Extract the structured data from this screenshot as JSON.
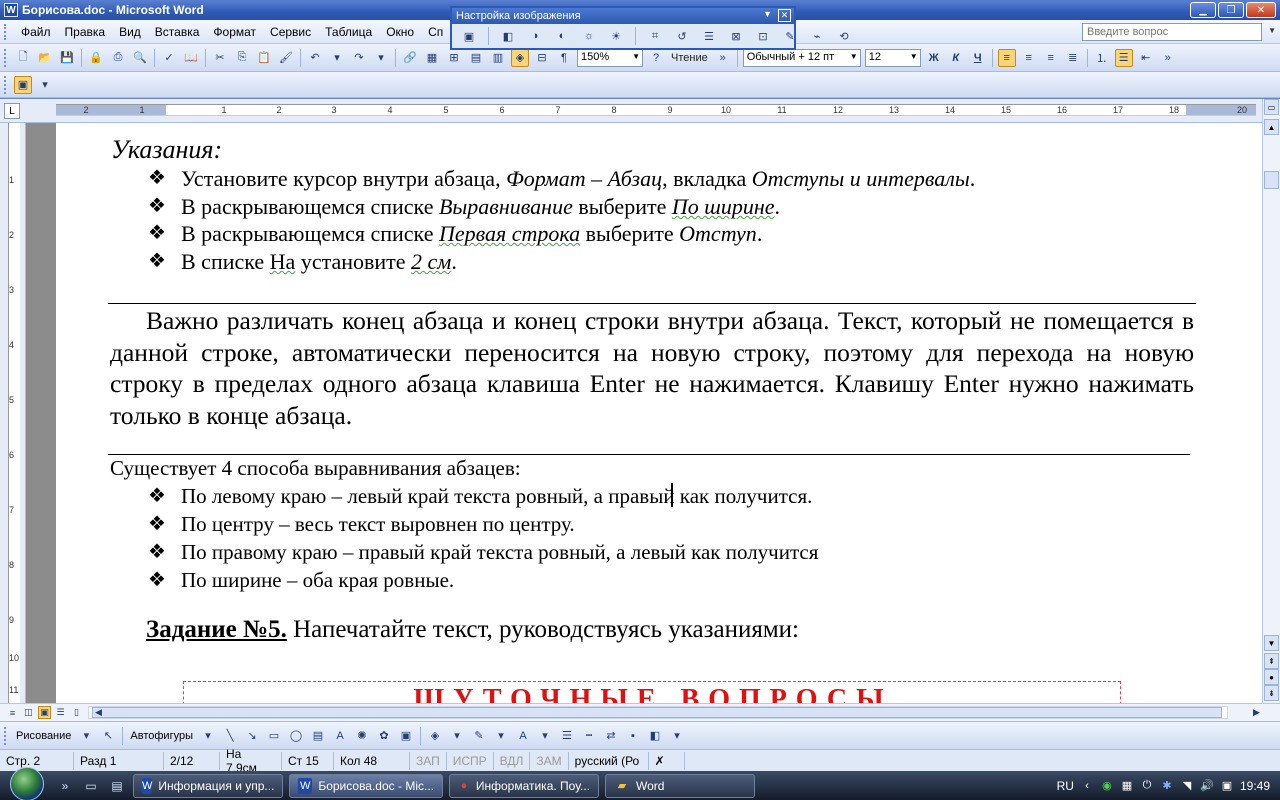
{
  "window": {
    "title": "Борисова.doc - Microsoft Word",
    "app_icon": "W"
  },
  "menu": {
    "items": [
      "Файл",
      "Правка",
      "Вид",
      "Вставка",
      "Формат",
      "Сервис",
      "Таблица",
      "Окно",
      "Сп"
    ],
    "ask_placeholder": "Введите вопрос"
  },
  "picture_toolbar": {
    "title": "Настройка изображения"
  },
  "toolbar": {
    "zoom": "150%",
    "reading": "Чтение",
    "style": "Обычный + 12 пт",
    "font_size": "12",
    "bold": "Ж",
    "italic": "К",
    "underline": "Ч"
  },
  "ruler": {
    "numbers": [
      "2",
      "1",
      "1",
      "2",
      "3",
      "4",
      "5",
      "6",
      "7",
      "8",
      "9",
      "10",
      "11",
      "12",
      "13",
      "14",
      "15",
      "16",
      "17",
      "18",
      "19",
      "20"
    ]
  },
  "vruler": {
    "numbers": [
      "1",
      "2",
      "3",
      "4",
      "5",
      "6",
      "7",
      "8",
      "9",
      "10",
      "11"
    ]
  },
  "document": {
    "heading": "Указания:",
    "instructions": [
      {
        "a": "Установите курсор внутри абзаца, ",
        "b": "Формат – Абзац",
        "c": ", вкладка ",
        "d": "Отступы и интервалы",
        "e": "."
      },
      {
        "a": "В раскрывающемся списке ",
        "b": "Выравнивание",
        "c": " выберите ",
        "d": "По ширине",
        "e": "."
      },
      {
        "a": "В раскрывающемся списке ",
        "b": "Первая строка",
        "c": " выберите ",
        "d": "Отступ",
        "e": "."
      },
      {
        "a": "В списке ",
        "b": "На",
        "c": " установите ",
        "d": "2 см",
        "e": "."
      }
    ],
    "paragraph": "Важно различать конец абзаца и конец строки внутри абзаца. Текст, который не помещается в данной строке, автоматически переносится на новую строку, поэтому для перехода на новую строку в пределах одного абзаца клавиша Enter не нажимается. Клавишу Enter нужно нажимать только в конце абзаца.",
    "intro": "Существует 4 способа выравнивания абзацев:",
    "methods": [
      "По левому краю – левый край текста ровный, а правый как получится.",
      "По центру – весь текст выровнен по центру.",
      "По правому краю – правый край текста ровный, а левый как получится",
      "По ширине – оба края ровные."
    ],
    "task_label": "Задание №5.",
    "task_text": " Напечатайте текст, руководствуясь указаниями:",
    "box_title": "ШУТОЧНЫЕ ВОПРОСЫ",
    "bullet": "❖"
  },
  "drawing": {
    "draw": "Рисование",
    "autoshapes": "Автофигуры"
  },
  "status": {
    "page": "Стр. 2",
    "section": "Разд 1",
    "pages": "2/12",
    "at": "На 7,9см",
    "line": "Ст 15",
    "col": "Кол 48",
    "rec": "ЗАП",
    "trk": "ИСПР",
    "ext": "ВДЛ",
    "ovr": "ЗАМ",
    "lang": "русский (Ро"
  },
  "taskbar": {
    "tasks": [
      {
        "label": "Информация и упр...",
        "icon": "W"
      },
      {
        "label": "Борисова.doc - Mic...",
        "icon": "W"
      },
      {
        "label": "Информатика. Поу...",
        "icon": "●"
      },
      {
        "label": "Word",
        "icon": "▰"
      }
    ],
    "lang": "RU",
    "clock": "19:49"
  },
  "colors": {
    "titlebar": "#2f5bb8",
    "accent_red": "#e01010",
    "active_button": "#f9d57a"
  }
}
